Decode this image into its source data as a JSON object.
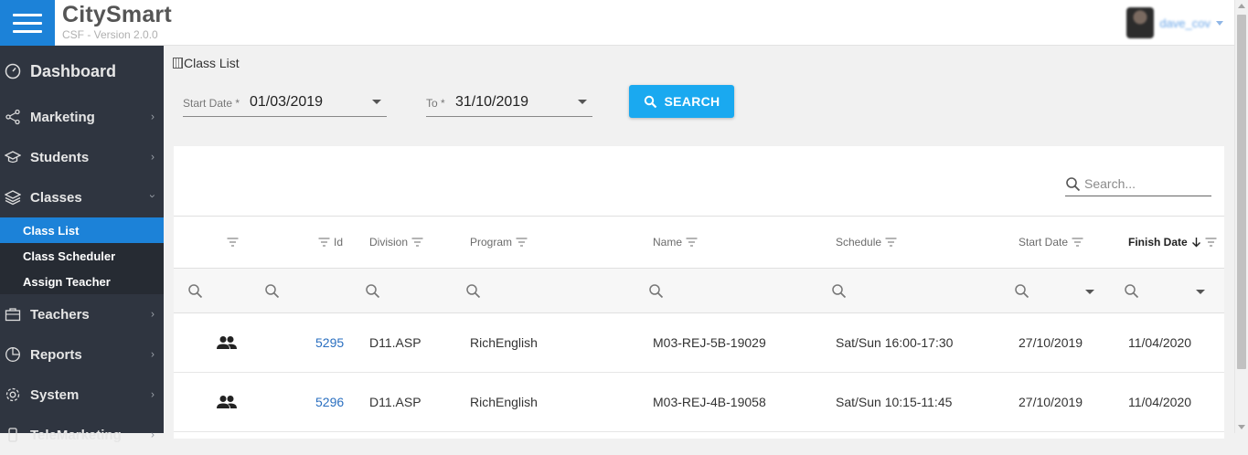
{
  "app": {
    "name": "CitySmart",
    "version": "CSF - Version 2.0.0"
  },
  "user": {
    "name": "dave_cov"
  },
  "sidebar": {
    "items": [
      {
        "label": "Dashboard"
      },
      {
        "label": "Marketing"
      },
      {
        "label": "Students"
      },
      {
        "label": "Classes"
      },
      {
        "label": "Teachers"
      },
      {
        "label": "Reports"
      },
      {
        "label": "System"
      },
      {
        "label": "TeleMarketing"
      }
    ],
    "classes_sub": [
      {
        "label": "Class List",
        "active": true
      },
      {
        "label": "Class Scheduler"
      },
      {
        "label": "Assign Teacher"
      }
    ]
  },
  "page": {
    "breadcrumb": "Class List"
  },
  "filters": {
    "start_label": "Start Date *",
    "start_value": "01/03/2019",
    "to_label": "To *",
    "to_value": "31/10/2019",
    "search_button": "SEARCH"
  },
  "grid": {
    "search_placeholder": "Search...",
    "columns": [
      "Id",
      "Division",
      "Program",
      "Name",
      "Schedule",
      "Start Date",
      "Finish Date"
    ],
    "rows": [
      {
        "id": "5295",
        "division": "D11.ASP",
        "program": "RichEnglish",
        "name": "M03-REJ-5B-19029",
        "schedule": "Sat/Sun 16:00-17:30",
        "start": "27/10/2019",
        "finish": "11/04/2020"
      },
      {
        "id": "5296",
        "division": "D11.ASP",
        "program": "RichEnglish",
        "name": "M03-REJ-4B-19058",
        "schedule": "Sat/Sun 10:15-11:45",
        "start": "27/10/2019",
        "finish": "11/04/2020"
      }
    ]
  },
  "colors": {
    "accent": "#1c82d8",
    "button": "#1aa9f0",
    "sidebar": "#2f3540",
    "link": "#2a6fc0"
  }
}
